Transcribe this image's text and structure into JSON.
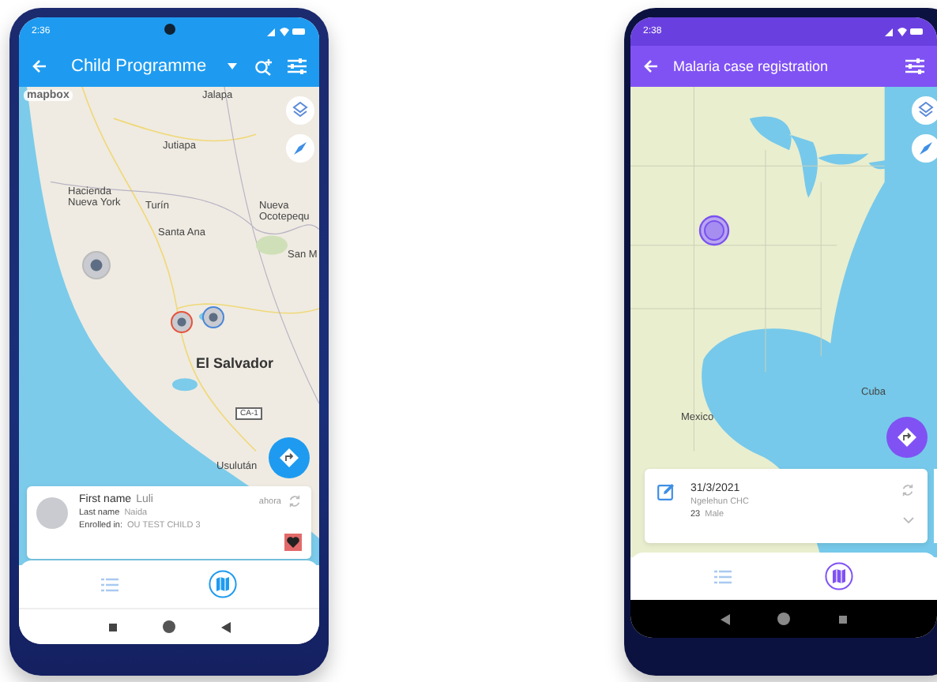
{
  "phones": [
    {
      "kind": "tei",
      "color": "#1e9bf0",
      "status_time": "2:36",
      "title": "Child Programme",
      "attribution": "mapbox",
      "map_labels": [
        "Jalapa",
        "Jutiapa",
        "Hacienda Nueva York",
        "Turín",
        "Santa Ana",
        "Nueva Ocotepequ",
        "San M",
        "El Salvador",
        "CA-1",
        "Usulután"
      ],
      "card": {
        "first_name_label": "First name",
        "first_name": "Luli",
        "last_name_label": "Last name",
        "last_name": "Naida",
        "enrolled_label": "Enrolled in:",
        "enrolled": "OU TEST CHILD 3",
        "time": "ahora"
      },
      "nav": [
        {
          "kind": "list",
          "selected": false
        },
        {
          "kind": "map",
          "selected": true
        }
      ]
    },
    {
      "kind": "event",
      "color": "#8052f4",
      "status_time": "2:38",
      "title": "Malaria case registration",
      "map_labels": [
        "Cuba",
        "Mexico"
      ],
      "card": {
        "date": "31/3/2021",
        "org_unit": "Ngelehun CHC",
        "age": "23",
        "sex": "Male"
      },
      "nav": [
        {
          "kind": "list",
          "selected": false
        },
        {
          "kind": "map",
          "selected": true
        }
      ]
    }
  ]
}
